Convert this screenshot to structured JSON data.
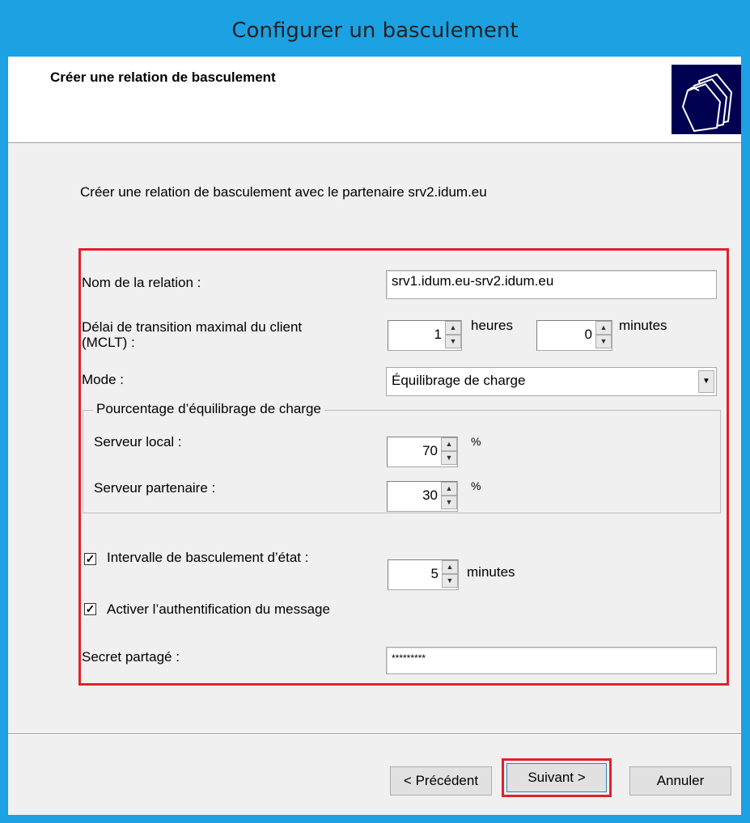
{
  "window": {
    "title": "Configurer un basculement"
  },
  "header": {
    "title": "Créer une relation de basculement"
  },
  "intro": "Créer une relation de basculement avec le partenaire srv2.idum.eu",
  "form": {
    "relation_name_label": "Nom de la relation :",
    "relation_name_value": "srv1.idum.eu-srv2.idum.eu",
    "mclt_label_line1": "Délai de transition maximal du client",
    "mclt_label_line2": "(MCLT) :",
    "mclt_hours": "1",
    "hours_label": "heures",
    "mclt_minutes": "0",
    "minutes_label": "minutes",
    "mode_label": "Mode :",
    "mode_value": "Équilibrage de charge",
    "lb_group_title": "Pourcentage d’équilibrage de charge",
    "local_server_label": "Serveur local :",
    "local_server_value": "70",
    "partner_server_label": "Serveur partenaire :",
    "partner_server_value": "30",
    "percent_sign": "%",
    "state_switch_checked": true,
    "state_switch_label": "Intervalle de basculement d’état :",
    "state_switch_value": "5",
    "state_switch_unit": "minutes",
    "auth_checked": true,
    "auth_label": "Activer l’authentification du message",
    "shared_secret_label": "Secret partagé :",
    "shared_secret_value": "*********"
  },
  "buttons": {
    "previous": "< Précédent",
    "next": "Suivant >",
    "cancel": "Annuler"
  },
  "colors": {
    "highlight": "#e3202a",
    "titlebar": "#1ca1e2"
  },
  "icons": {
    "header": "folders-icon",
    "check": "checkmark-icon",
    "spin_up": "spin-up-icon",
    "spin_down": "spin-down-icon",
    "dropdown": "dropdown-arrow-icon"
  }
}
